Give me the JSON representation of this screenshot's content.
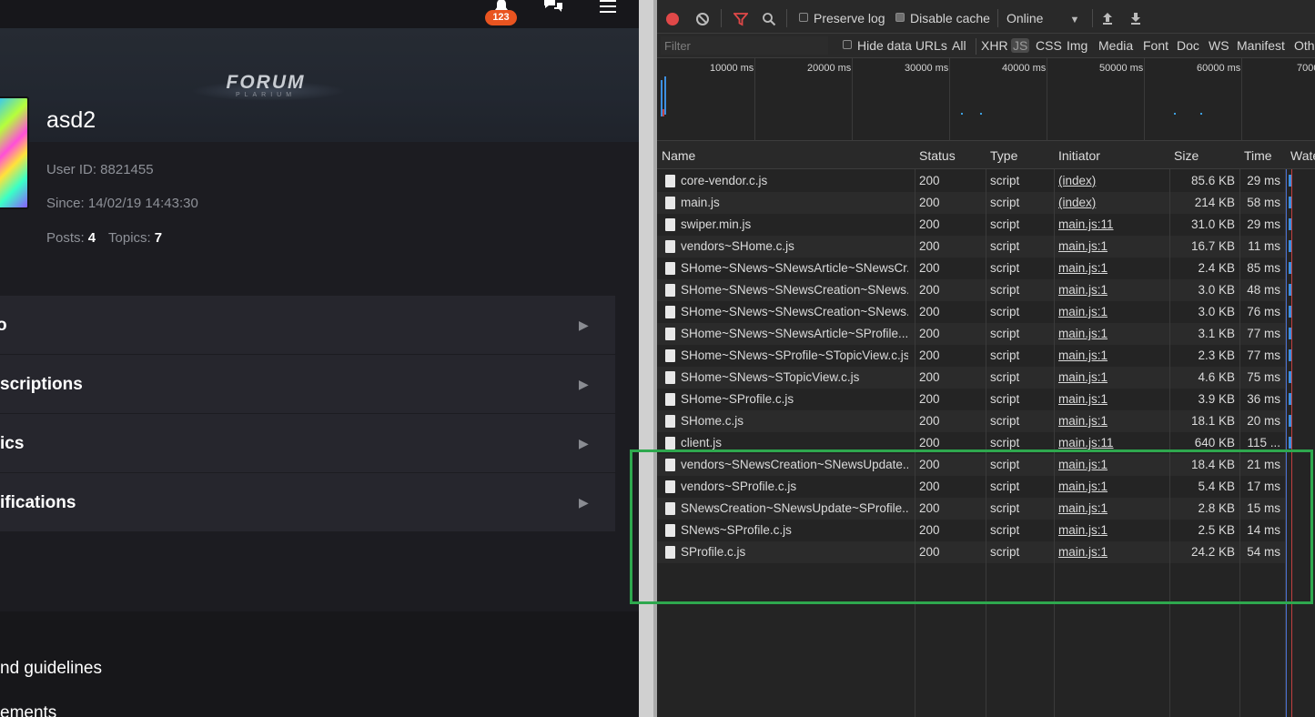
{
  "forum": {
    "notifications_count": "123",
    "logo_main": "FORUM",
    "logo_sub": "PLARIUM",
    "username": "asd2",
    "user_id": "User ID: 8821455",
    "since": "Since: 14/02/19 14:43:30",
    "posts_label": "Posts:",
    "posts_value": "4",
    "topics_label": "Topics:",
    "topics_value": "7",
    "menu_items": [
      "o",
      "scriptions",
      "ics",
      "ifications"
    ],
    "footer_links": [
      "nd guidelines",
      "ements"
    ]
  },
  "devtools": {
    "toolbar": {
      "preserve_log": "Preserve log",
      "disable_cache": "Disable cache",
      "throttling": "Online"
    },
    "filterbar": {
      "placeholder": "Filter",
      "hide_data_urls": "Hide data URLs",
      "types": [
        "All",
        "XHR",
        "JS",
        "CSS",
        "Img",
        "Media",
        "Font",
        "Doc",
        "WS",
        "Manifest",
        "Oth"
      ],
      "active_type": "JS"
    },
    "overview_ticks": [
      "10000 ms",
      "20000 ms",
      "30000 ms",
      "40000 ms",
      "50000 ms",
      "60000 ms",
      "7000"
    ],
    "columns": [
      "Name",
      "Status",
      "Type",
      "Initiator",
      "Size",
      "Time",
      "Wate"
    ],
    "rows": [
      {
        "name": "core-vendor.c.js",
        "status": "200",
        "type": "script",
        "initiator": "(index)",
        "size": "85.6 KB",
        "time": "29 ms"
      },
      {
        "name": "main.js",
        "status": "200",
        "type": "script",
        "initiator": "(index)",
        "size": "214 KB",
        "time": "58 ms"
      },
      {
        "name": "swiper.min.js",
        "status": "200",
        "type": "script",
        "initiator": "main.js:11",
        "size": "31.0 KB",
        "time": "29 ms"
      },
      {
        "name": "vendors~SHome.c.js",
        "status": "200",
        "type": "script",
        "initiator": "main.js:1",
        "size": "16.7 KB",
        "time": "11 ms"
      },
      {
        "name": "SHome~SNews~SNewsArticle~SNewsCr...",
        "status": "200",
        "type": "script",
        "initiator": "main.js:1",
        "size": "2.4 KB",
        "time": "85 ms"
      },
      {
        "name": "SHome~SNews~SNewsCreation~SNews...",
        "status": "200",
        "type": "script",
        "initiator": "main.js:1",
        "size": "3.0 KB",
        "time": "48 ms"
      },
      {
        "name": "SHome~SNews~SNewsCreation~SNews...",
        "status": "200",
        "type": "script",
        "initiator": "main.js:1",
        "size": "3.0 KB",
        "time": "76 ms"
      },
      {
        "name": "SHome~SNews~SNewsArticle~SProfile...",
        "status": "200",
        "type": "script",
        "initiator": "main.js:1",
        "size": "3.1 KB",
        "time": "77 ms"
      },
      {
        "name": "SHome~SNews~SProfile~STopicView.c.js",
        "status": "200",
        "type": "script",
        "initiator": "main.js:1",
        "size": "2.3 KB",
        "time": "77 ms"
      },
      {
        "name": "SHome~SNews~STopicView.c.js",
        "status": "200",
        "type": "script",
        "initiator": "main.js:1",
        "size": "4.6 KB",
        "time": "75 ms"
      },
      {
        "name": "SHome~SProfile.c.js",
        "status": "200",
        "type": "script",
        "initiator": "main.js:1",
        "size": "3.9 KB",
        "time": "36 ms"
      },
      {
        "name": "SHome.c.js",
        "status": "200",
        "type": "script",
        "initiator": "main.js:1",
        "size": "18.1 KB",
        "time": "20 ms"
      },
      {
        "name": "client.js",
        "status": "200",
        "type": "script",
        "initiator": "main.js:11",
        "size": "640 KB",
        "time": "115 ..."
      },
      {
        "name": "vendors~SNewsCreation~SNewsUpdate...",
        "status": "200",
        "type": "script",
        "initiator": "main.js:1",
        "size": "18.4 KB",
        "time": "21 ms"
      },
      {
        "name": "vendors~SProfile.c.js",
        "status": "200",
        "type": "script",
        "initiator": "main.js:1",
        "size": "5.4 KB",
        "time": "17 ms"
      },
      {
        "name": "SNewsCreation~SNewsUpdate~SProfile...",
        "status": "200",
        "type": "script",
        "initiator": "main.js:1",
        "size": "2.8 KB",
        "time": "15 ms"
      },
      {
        "name": "SNews~SProfile.c.js",
        "status": "200",
        "type": "script",
        "initiator": "main.js:1",
        "size": "2.5 KB",
        "time": "14 ms"
      },
      {
        "name": "SProfile.c.js",
        "status": "200",
        "type": "script",
        "initiator": "main.js:1",
        "size": "24.2 KB",
        "time": "54 ms"
      }
    ]
  }
}
